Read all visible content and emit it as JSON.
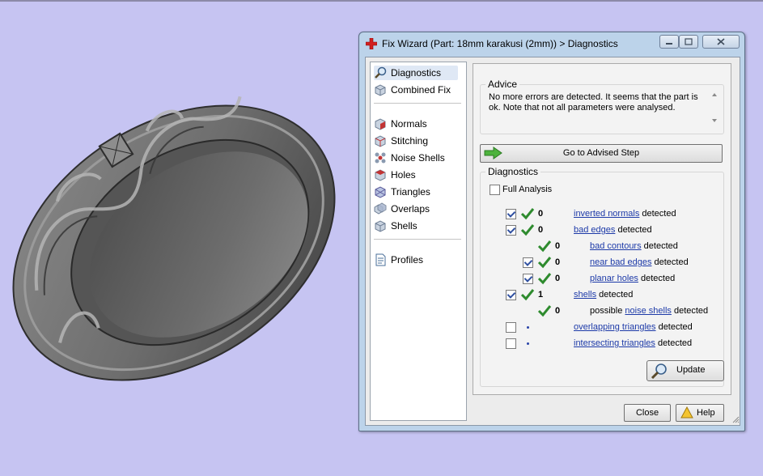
{
  "window": {
    "title": "Fix Wizard (Part: 18mm karakusi (2mm)) > Diagnostics",
    "controls": [
      "minimize",
      "maximize",
      "close"
    ]
  },
  "nav": {
    "items": [
      {
        "label": "Diagnostics",
        "icon": "magnifier-icon",
        "selected": true
      },
      {
        "label": "Combined Fix",
        "icon": "cube-icon"
      },
      {
        "label": "Normals",
        "icon": "normals-cube-icon"
      },
      {
        "label": "Stitching",
        "icon": "stitching-cube-icon"
      },
      {
        "label": "Noise Shells",
        "icon": "noise-shells-icon"
      },
      {
        "label": "Holes",
        "icon": "holes-cube-icon"
      },
      {
        "label": "Triangles",
        "icon": "triangles-icon"
      },
      {
        "label": "Overlaps",
        "icon": "overlaps-icon"
      },
      {
        "label": "Shells",
        "icon": "shells-icon"
      },
      {
        "label": "Profiles",
        "icon": "document-icon"
      }
    ]
  },
  "advice": {
    "group_label": "Advice",
    "text": "No more errors are detected. It seems that the part is ok. Note that not all parameters were analysed."
  },
  "advised_button": {
    "label": "Go to Advised Step"
  },
  "diagnostics": {
    "group_label": "Diagnostics",
    "full_analysis": {
      "label": "Full Analysis",
      "checked": false
    },
    "rows": [
      {
        "checked": true,
        "status": "ok",
        "count": "0",
        "prefix": "",
        "link": "inverted normals",
        "suffix": " detected"
      },
      {
        "checked": true,
        "status": "ok",
        "count": "0",
        "prefix": "",
        "link": "bad edges",
        "suffix": " detected"
      },
      {
        "checked": null,
        "status": "ok",
        "count": "0",
        "prefix": "",
        "link": "bad contours",
        "suffix": " detected"
      },
      {
        "checked": true,
        "status": "ok",
        "count": "0",
        "prefix": "",
        "link": "near bad edges",
        "suffix": " detected"
      },
      {
        "checked": true,
        "status": "ok",
        "count": "0",
        "prefix": "",
        "link": "planar holes",
        "suffix": " detected"
      },
      {
        "checked": true,
        "status": "ok",
        "count": "1",
        "prefix": "",
        "link": "shells",
        "suffix": " detected"
      },
      {
        "checked": null,
        "status": "ok",
        "count": "0",
        "prefix": "possible ",
        "link": "noise shells",
        "suffix": " detected"
      },
      {
        "checked": false,
        "status": "pending",
        "count": "",
        "prefix": "",
        "link": "overlapping triangles",
        "suffix": " detected"
      },
      {
        "checked": false,
        "status": "pending",
        "count": "",
        "prefix": "",
        "link": "intersecting triangles",
        "suffix": " detected"
      }
    ],
    "update_label": "Update"
  },
  "footer": {
    "close_label": "Close",
    "help_label": "Help"
  },
  "colors": {
    "viewport_bg": "#c6c4f2",
    "ring": "#7a7a7a",
    "window_frame": "#bcd3ea",
    "link": "#1d3aa8",
    "tick": "#2e8b2e"
  }
}
